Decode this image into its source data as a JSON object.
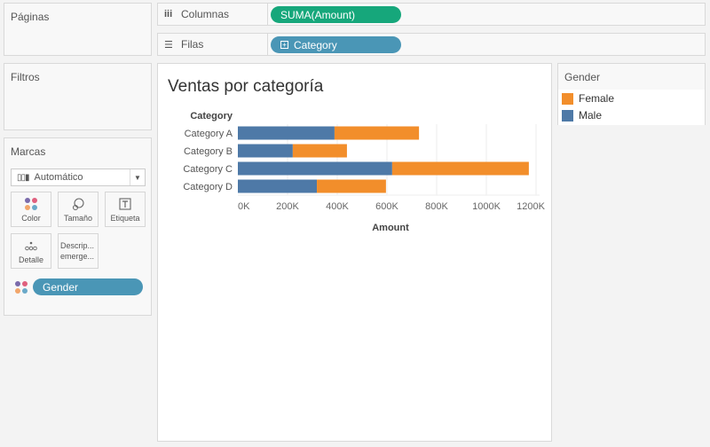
{
  "panels": {
    "pages_title": "Páginas",
    "filters_title": "Filtros",
    "marks_title": "Marcas"
  },
  "shelves": {
    "columns": {
      "label": "Columnas",
      "icon": "columns-icon",
      "pill": "SUMA(Amount)"
    },
    "rows": {
      "label": "Filas",
      "icon": "rows-icon",
      "pill": "Category"
    }
  },
  "marks": {
    "mark_type": "Automático",
    "buttons": [
      {
        "label": "Color",
        "icon": "color-icon"
      },
      {
        "label": "Tamaño",
        "icon": "size-icon"
      },
      {
        "label": "Etiqueta",
        "icon": "label-icon"
      },
      {
        "label": "Detalle",
        "icon": "detail-icon"
      },
      {
        "label": "Descrip... emerge...",
        "icon": "tooltip-icon"
      }
    ],
    "color_field": "Gender"
  },
  "colors": {
    "male": "#4e79a7",
    "female": "#f28e2b",
    "pill_green": "#16a77b",
    "pill_blue": "#4a96b6"
  },
  "legend": {
    "title": "Gender",
    "items": [
      {
        "label": "Female",
        "color": "#f28e2b"
      },
      {
        "label": "Male",
        "color": "#4e79a7"
      }
    ]
  },
  "chart_data": {
    "type": "bar",
    "orientation": "horizontal",
    "stacked": true,
    "title": "Ventas por categoría",
    "row_header": "Category",
    "categories": [
      "Category A",
      "Category B",
      "Category C",
      "Category D"
    ],
    "series": [
      {
        "name": "Male",
        "color": "#4e79a7",
        "values": [
          389000,
          221000,
          621000,
          318000
        ]
      },
      {
        "name": "Female",
        "color": "#f28e2b",
        "values": [
          340000,
          218000,
          550000,
          278000
        ]
      }
    ],
    "xlabel": "Amount",
    "ylabel": "Category",
    "xlim": [
      0,
      1200000
    ],
    "xticks": [
      0,
      200000,
      400000,
      600000,
      800000,
      1000000,
      1200000
    ],
    "xtick_labels": [
      "0K",
      "200K",
      "400K",
      "600K",
      "800K",
      "1000K",
      "1200K"
    ],
    "grid": true,
    "legend_position": "right"
  }
}
